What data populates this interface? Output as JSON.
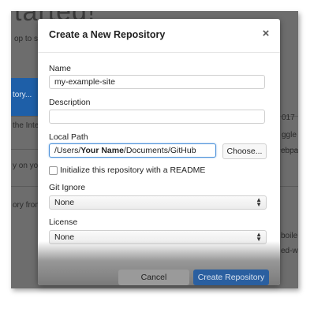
{
  "background": {
    "heading": "tarted!",
    "blue_item": "tory...",
    "left_lines": [
      "op to sta",
      "the Inte",
      "y on you",
      "ory from"
    ],
    "right_lines": [
      "017",
      "ggle",
      "ebpa",
      "boile",
      "ed-w"
    ]
  },
  "modal": {
    "title": "Create a New Repository",
    "close_icon": "×",
    "name_label": "Name",
    "name_value": "my-example-site",
    "description_label": "Description",
    "description_value": "",
    "local_path_label": "Local Path",
    "local_path_prefix": "/Users/",
    "local_path_user": "Your Name",
    "local_path_suffix": "/Documents/GitHub",
    "choose_label": "Choose...",
    "readme_label": "Initialize this repository with a README",
    "readme_checked": false,
    "git_ignore_label": "Git Ignore",
    "git_ignore_value": "None",
    "license_label": "License",
    "license_value": "None",
    "cancel_label": "Cancel",
    "create_label": "Create Repository"
  },
  "colors": {
    "accent": "#2a5fa0",
    "focus_border": "#4a90d9"
  }
}
